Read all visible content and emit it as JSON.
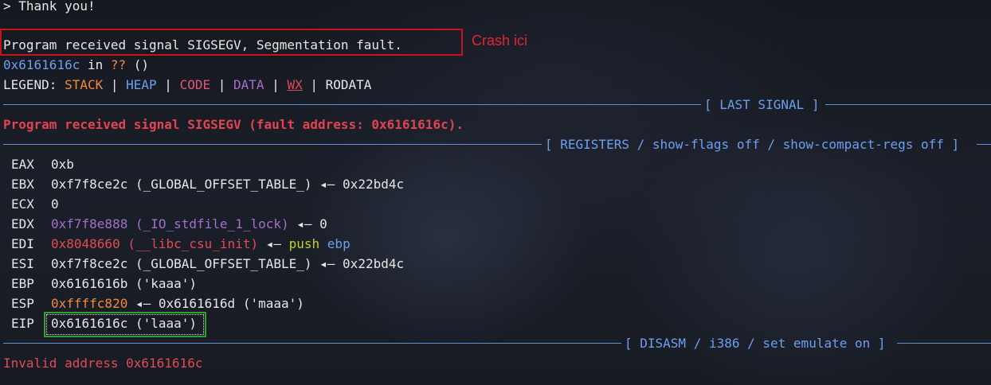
{
  "terminal": {
    "prompt_line": "> Thank you!",
    "crash_message": "Program received signal SIGSEGV, Segmentation fault.",
    "frame": {
      "address": "0x6161616c",
      "in": " in ",
      "func": "??",
      "args": " ()"
    },
    "legend": {
      "prefix": "LEGEND: ",
      "stack": "STACK",
      "heap": "HEAP",
      "code": "CODE",
      "data": "DATA",
      "wx": "WX",
      "rodata": "RODATA",
      "sep": " | "
    },
    "last_signal_title": "[ LAST SIGNAL ]",
    "fault_message": "Program received signal SIGSEGV (fault address: 0x6161616c).",
    "registers_title": "[ REGISTERS / show-flags off / show-compact-regs off ]",
    "registers": [
      {
        "name": "EAX",
        "parts": [
          {
            "text": "0xb",
            "color": "white"
          }
        ]
      },
      {
        "name": "EBX",
        "parts": [
          {
            "text": "0xf7f8ce2c (_GLOBAL_OFFSET_TABLE_)",
            "color": "white"
          },
          {
            "text": " ◂— ",
            "color": "white"
          },
          {
            "text": "0x22bd4c",
            "color": "white"
          }
        ]
      },
      {
        "name": "ECX",
        "parts": [
          {
            "text": "0",
            "color": "white"
          }
        ]
      },
      {
        "name": "EDX",
        "parts": [
          {
            "text": "0xf7f8e888 (_IO_stdfile_1_lock)",
            "color": "purple"
          },
          {
            "text": " ◂— ",
            "color": "white"
          },
          {
            "text": "0",
            "color": "white"
          }
        ]
      },
      {
        "name": "EDI",
        "parts": [
          {
            "text": "0x8048660 (__libc_csu_init)",
            "color": "red"
          },
          {
            "text": " ◂— ",
            "color": "white"
          },
          {
            "text": "push",
            "color": "lime"
          },
          {
            "text": " ",
            "color": "white"
          },
          {
            "text": "ebp",
            "color": "blue"
          }
        ]
      },
      {
        "name": "ESI",
        "parts": [
          {
            "text": "0xf7f8ce2c (_GLOBAL_OFFSET_TABLE_)",
            "color": "white"
          },
          {
            "text": " ◂— ",
            "color": "white"
          },
          {
            "text": "0x22bd4c",
            "color": "white"
          }
        ]
      },
      {
        "name": "EBP",
        "parts": [
          {
            "text": "0x6161616b ('kaaa')",
            "color": "white"
          }
        ]
      },
      {
        "name": "ESP",
        "parts": [
          {
            "text": "0xffffc820",
            "color": "orange"
          },
          {
            "text": " ◂— ",
            "color": "white"
          },
          {
            "text": "0x6161616d ('maaa')",
            "color": "white"
          }
        ]
      },
      {
        "name": "EIP",
        "parts": [
          {
            "text": "0x6161616c ('laaa')",
            "color": "white"
          }
        ]
      }
    ],
    "disasm_title": "[ DISASM / i386 / set emulate on ]",
    "invalid_address": "Invalid address 0x6161616c"
  },
  "annotations": {
    "crash_label": "Crash ici",
    "crash_box_color": "#c4141c",
    "eip_box_color": "#2ea12e"
  },
  "colors": {
    "rule": "#5f8fd8",
    "stack": "#f08a3c",
    "heap": "#6c9ff0",
    "code": "#e0567a",
    "data": "#a270c8",
    "wx": "#e24a55",
    "error": "#e0444f"
  }
}
